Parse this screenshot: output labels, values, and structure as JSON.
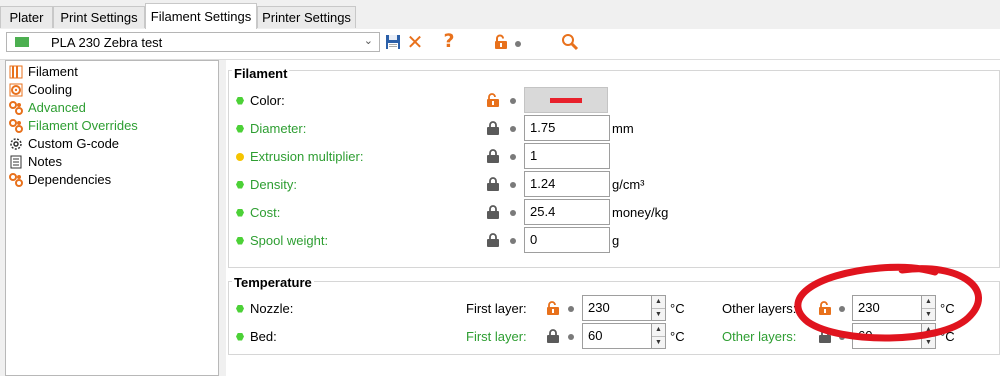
{
  "tabs": [
    {
      "label": "Plater"
    },
    {
      "label": "Print Settings"
    },
    {
      "label": "Filament Settings"
    },
    {
      "label": "Printer Settings"
    }
  ],
  "preset": {
    "name": "PLA 230 Zebra test"
  },
  "sidebar": {
    "items": [
      {
        "label": "Filament"
      },
      {
        "label": "Cooling"
      },
      {
        "label": "Advanced"
      },
      {
        "label": "Filament Overrides"
      },
      {
        "label": "Custom G-code"
      },
      {
        "label": "Notes"
      },
      {
        "label": "Dependencies"
      }
    ]
  },
  "filament": {
    "title": "Filament",
    "color_label": "Color:",
    "color_value": "#e8212c",
    "diameter_label": "Diameter:",
    "diameter_value": "1.75",
    "diameter_unit": "mm",
    "extrusion_label": "Extrusion multiplier:",
    "extrusion_value": "1",
    "density_label": "Density:",
    "density_value": "1.24",
    "density_unit": "g/cm³",
    "cost_label": "Cost:",
    "cost_value": "25.4",
    "cost_unit": "money/kg",
    "spool_label": "Spool weight:",
    "spool_value": "0",
    "spool_unit": "g"
  },
  "temperature": {
    "title": "Temperature",
    "nozzle_label": "Nozzle:",
    "bed_label": "Bed:",
    "first_layer_label": "First layer:",
    "other_layers_label": "Other layers:",
    "nozzle_first": "230",
    "nozzle_other": "230",
    "bed_first": "60",
    "bed_other": "60",
    "unit": "°C"
  },
  "colors": {
    "accent_orange": "#e8711c",
    "green": "#2e9e32",
    "yellow": "#f5c400",
    "annotation_red": "#e0141e",
    "lock_gray": "#5a5a5a"
  }
}
